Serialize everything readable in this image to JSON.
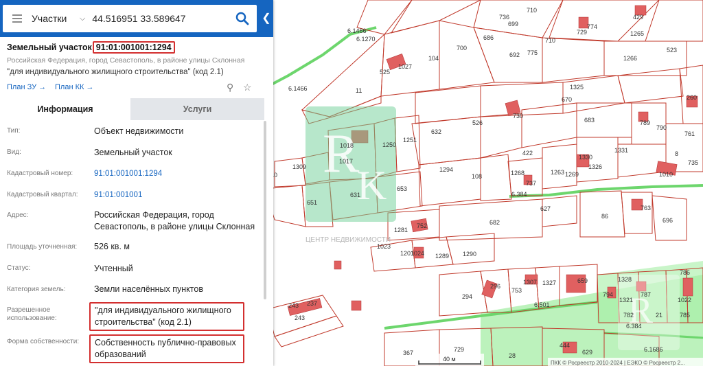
{
  "search": {
    "category": "Участки",
    "query": "44.516951 33.589647"
  },
  "card": {
    "title_prefix": "Земельный участок",
    "cadastral_number": "91:01:001001:1294",
    "address_line": "Российская Федерация, город Севастополь, в районе улицы Склонная",
    "use_line": "\"для индивидуального жилищного строительства\" (код 2.1)",
    "link_plan_zu": "План ЗУ →",
    "link_plan_kk": "План КК →"
  },
  "tabs": {
    "info": "Информация",
    "services": "Услуги"
  },
  "rows": [
    {
      "label": "Тип:",
      "value": "Объект недвижимости"
    },
    {
      "label": "Вид:",
      "value": "Земельный участок"
    },
    {
      "label": "Кадастровый номер:",
      "value": "91:01:001001:1294"
    },
    {
      "label": "Кадастровый квартал:",
      "value": "91:01:001001"
    },
    {
      "label": "Адрес:",
      "value": "Российская Федерация, город Севастополь, в районе улицы Склонная"
    },
    {
      "label": "Площадь уточненная:",
      "value": "526 кв. м"
    },
    {
      "label": "Статус:",
      "value": "Учтенный"
    },
    {
      "label": "Категория земель:",
      "value": "Земли населённых пунктов"
    },
    {
      "label": "Разрешенное использование:",
      "value": "\"для индивидуального жилищного строительства\" (код 2.1)"
    },
    {
      "label": "Форма собственности:",
      "value": "Собственность публично-правовых образований"
    }
  ],
  "map": {
    "watermark_text": "ЦЕНТР НЕДВИЖИМОСТИ",
    "scale": "40 м",
    "copyright": "ПКК © Росреестр 2010-2024 | ЕЭКО © Росреестр 2...",
    "labels": [
      "6.1466",
      "6.1270",
      "736",
      "699",
      "710",
      "729",
      "774",
      "429",
      "1265",
      "523",
      "1266",
      "1027",
      "525",
      "104",
      "700",
      "686",
      "692",
      "775",
      "710",
      "6.1466",
      "11",
      "1325",
      "670",
      "260",
      "632",
      "526",
      "730",
      "422",
      "683",
      "789",
      "790",
      "761",
      "1309",
      "1310",
      "1018",
      "1250",
      "1251",
      "1331",
      "1330",
      "1326",
      "8",
      "735",
      "1017",
      "108",
      "1294",
      "1263",
      "1269",
      "1268",
      "737",
      "1010",
      "6.384",
      "653",
      "631",
      "651",
      "627",
      "763",
      "86",
      "696",
      "1281",
      "752",
      "682",
      "1023",
      "1201",
      "1024",
      "1289",
      "1290",
      "294",
      "296",
      "753",
      "1307",
      "1327",
      "659",
      "794",
      "1328",
      "1321",
      "787",
      "786",
      "1022",
      "243",
      "237",
      "243",
      "6.501",
      "782",
      "21",
      "785",
      "6.384",
      "6.1686",
      "367",
      "729",
      "28",
      "444",
      "629"
    ],
    "colors": {
      "parcel_line": "#c0392b",
      "building_fill": "#e06060",
      "green_zone": "#9be79b",
      "road": "#6dd66d",
      "logo": "#8fd6a4"
    }
  }
}
